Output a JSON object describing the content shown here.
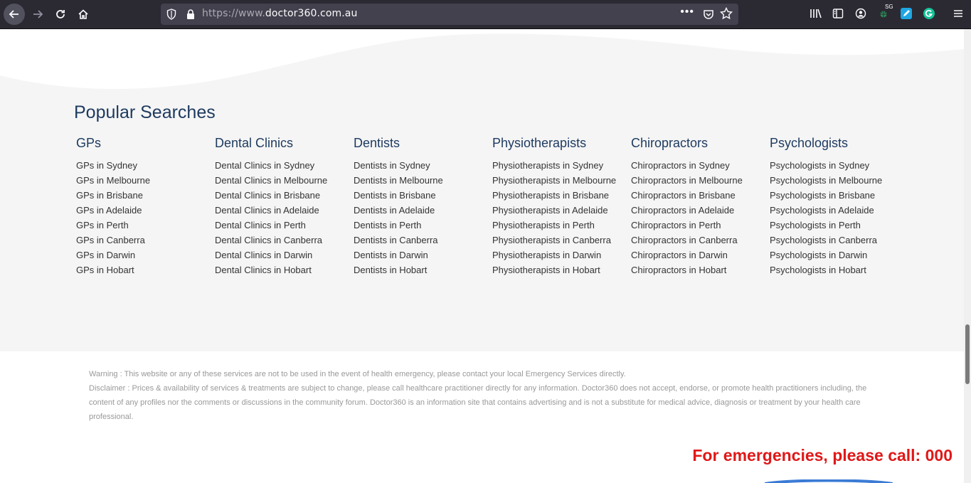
{
  "browser": {
    "url_prefix": "https://www.",
    "url_domain": "doctor360.com.au",
    "more_label": "•••",
    "ext_badge": "SG"
  },
  "popular": {
    "title": "Popular Searches",
    "columns": [
      {
        "title": "GPs",
        "links": [
          "GPs in Sydney",
          "GPs in Melbourne",
          "GPs in Brisbane",
          "GPs in Adelaide",
          "GPs in Perth",
          "GPs in Canberra",
          "GPs in Darwin",
          "GPs in Hobart"
        ]
      },
      {
        "title": "Dental Clinics",
        "links": [
          "Dental Clinics in Sydney",
          "Dental Clinics in Melbourne",
          "Dental Clinics in Brisbane",
          "Dental Clinics in Adelaide",
          "Dental Clinics in Perth",
          "Dental Clinics in Canberra",
          "Dental Clinics in Darwin",
          "Dental Clinics in Hobart"
        ]
      },
      {
        "title": "Dentists",
        "links": [
          "Dentists in Sydney",
          "Dentists in Melbourne",
          "Dentists in Brisbane",
          "Dentists in Adelaide",
          "Dentists in Perth",
          "Dentists in Canberra",
          "Dentists in Darwin",
          "Dentists in Hobart"
        ]
      },
      {
        "title": "Physiotherapists",
        "links": [
          "Physiotherapists in Sydney",
          "Physiotherapists in Melbourne",
          "Physiotherapists in Brisbane",
          "Physiotherapists in Adelaide",
          "Physiotherapists in Perth",
          "Physiotherapists in Canberra",
          "Physiotherapists in Darwin",
          "Physiotherapists in Hobart"
        ]
      },
      {
        "title": "Chiropractors",
        "links": [
          "Chiropractors in Sydney",
          "Chiropractors in Melbourne",
          "Chiropractors in Brisbane",
          "Chiropractors in Adelaide",
          "Chiropractors in Perth",
          "Chiropractors in Canberra",
          "Chiropractors in Darwin",
          "Chiropractors in Hobart"
        ]
      },
      {
        "title": "Psychologists",
        "links": [
          "Psychologists in Sydney",
          "Psychologists in Melbourne",
          "Psychologists in Brisbane",
          "Psychologists in Adelaide",
          "Psychologists in Perth",
          "Psychologists in Canberra",
          "Psychologists in Darwin",
          "Psychologists in Hobart"
        ]
      }
    ]
  },
  "footer": {
    "warning": "Warning : This website or any of these services are not to be used in the event of health emergency, please contact your local Emergency Services directly.",
    "disclaimer": "Disclaimer : Prices & availability of services & treatments are subject to change, please call healthcare practitioner directly for any information. Doctor360 does not accept, endorse, or promote health practitioners including, the content of any profiles nor the comments or discussions in the community forum. Doctor360 is an information site that contains advertising and is not a substitute for medical advice, diagnosis or treatment by your health care professional.",
    "emergency": "For emergencies, please call: 000"
  },
  "colors": {
    "heading": "#1d3a5f",
    "emergency": "#e01818",
    "section_bg": "#f5f5f5"
  }
}
